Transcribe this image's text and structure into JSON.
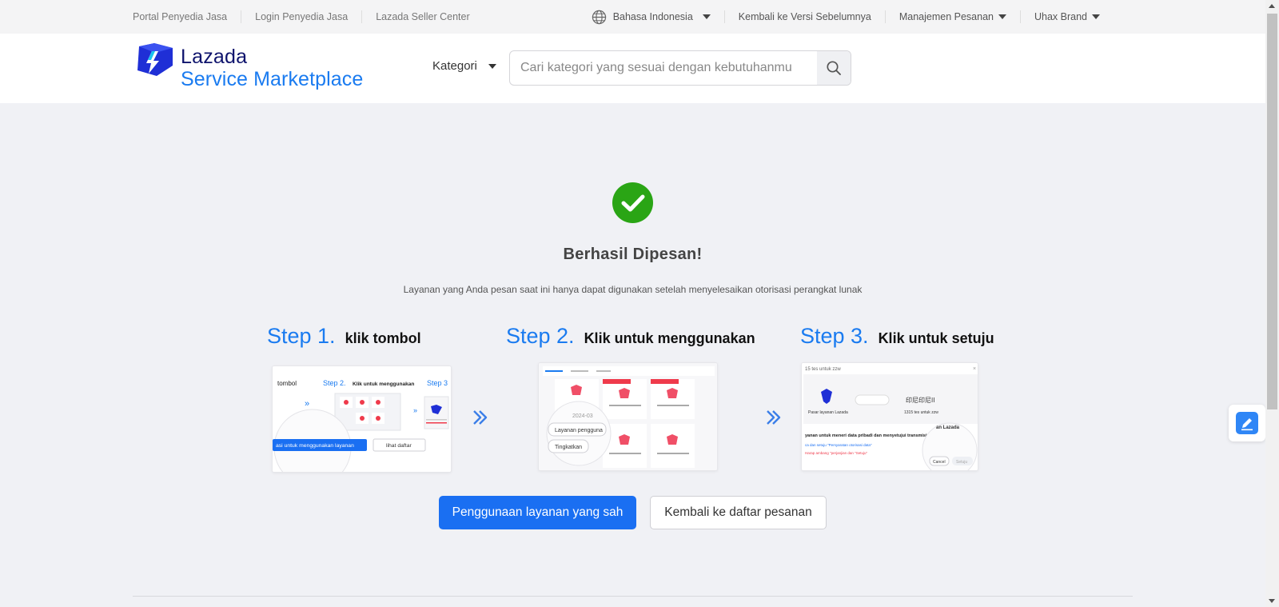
{
  "topbar": {
    "left_links": [
      "Portal Penyedia Jasa",
      "Login Penyedia Jasa",
      "Lazada Seller Center"
    ],
    "language": "Bahasa Indonesia",
    "back_version": "Kembali ke Versi Sebelumnya",
    "order_management": "Manajemen Pesanan",
    "brand": "Uhax Brand"
  },
  "header": {
    "logo_line1": "Lazada",
    "logo_line2": "Service Marketplace",
    "category_label": "Kategori",
    "search_placeholder": "Cari kategori yang sesuai dengan kebutuhanmu"
  },
  "main": {
    "title": "Berhasil Dipesan!",
    "subtitle": "Layanan yang Anda pesan saat ini hanya dapat digunakan setelah menyelesaikan otorisasi perangkat lunak",
    "steps": [
      {
        "num": "Step 1.",
        "text": "klik tombol"
      },
      {
        "num": "Step 2.",
        "text": "Klik untuk menggunakan"
      },
      {
        "num": "Step 3.",
        "text": "Klik untuk setuju"
      }
    ],
    "thumb1": {
      "tombol": "tombol",
      "step2": "Step 2.",
      "klik": "Klik untuk menggunakan",
      "step3": "Step 3",
      "use_btn": "asi untuk menggunakan layanan",
      "list_btn": "lihat daftar"
    },
    "thumb2": {
      "btn1": "Layanan pengguna",
      "btn2": "Tingkatkan",
      "date": "2024-03"
    },
    "thumb3": {
      "head": "15 tes untuk zzw",
      "partner": "Pasar layanan Lazada",
      "code": "印尼印尼II",
      "zzw": "1315 tes untuk zzw",
      "consent": "yanan untuk meneri data pribadi dan menyetujui transmisi data",
      "link1": "ca dan setuju \"Persyaratan otorisasi data\"",
      "link2": "Harap ambang \"perjanjian dan \"Setuju\"",
      "lz": "an Lazada",
      "cancel": "Cancel",
      "setuju": "Setuju"
    },
    "primary_button": "Penggunaan layanan yang sah",
    "secondary_button": "Kembali ke daftar pesanan"
  },
  "colors": {
    "accent": "#1a6ff2",
    "success": "#2aa515",
    "brand_dark": "#0f146d",
    "brand_blue": "#1a7bf0"
  }
}
